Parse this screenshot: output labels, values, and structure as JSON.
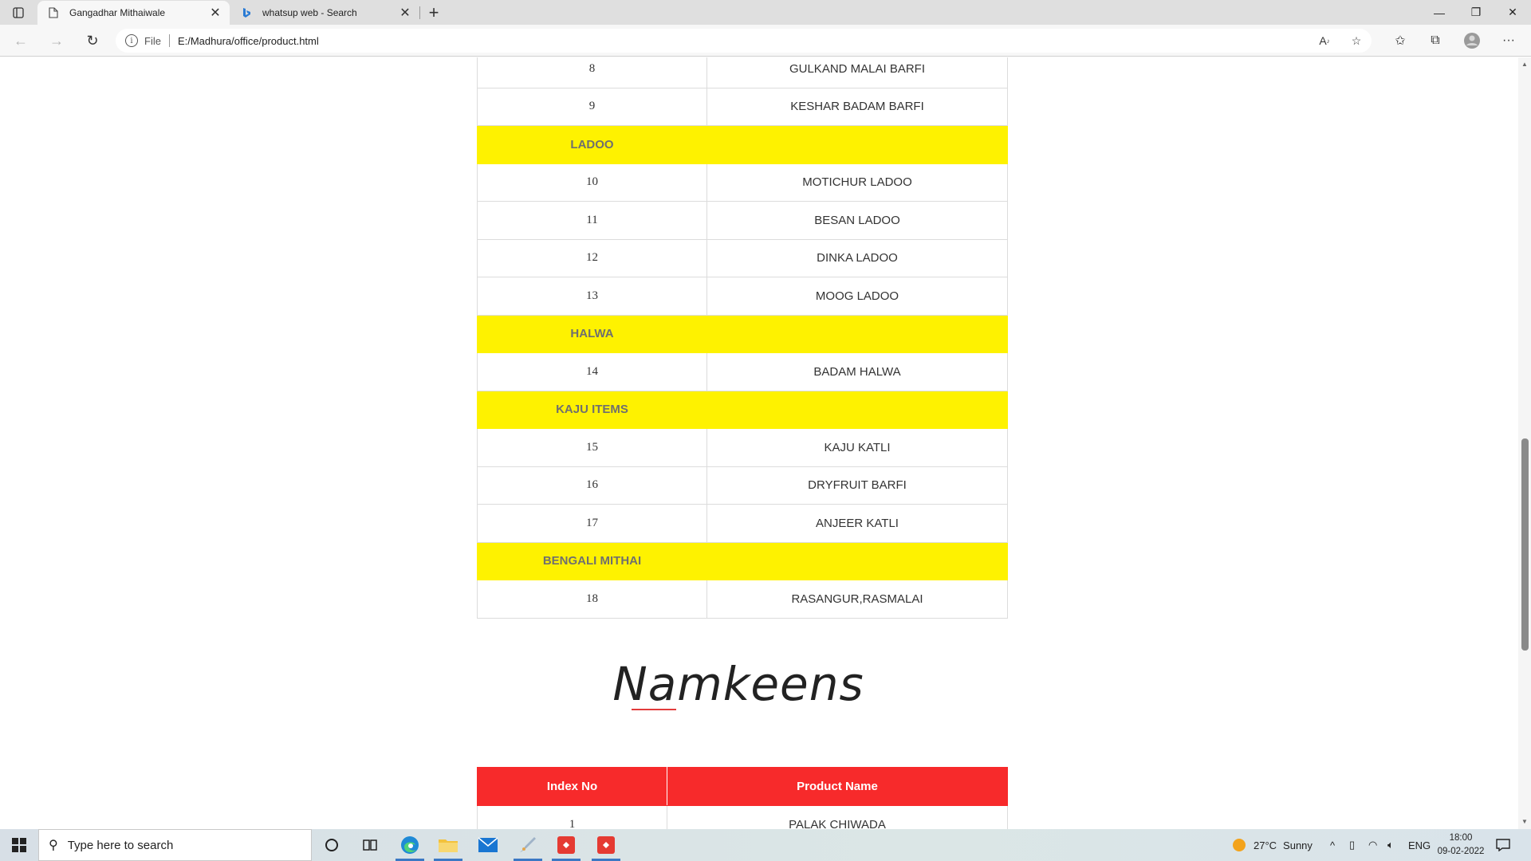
{
  "browser": {
    "tabs": [
      {
        "title": "Gangadhar Mithaiwale",
        "icon": "page-icon",
        "active": true
      },
      {
        "title": "whatsup web - Search",
        "icon": "bing-icon",
        "active": false
      }
    ],
    "address": {
      "scheme_label": "File",
      "url": "E:/Madhura/office/product.html"
    }
  },
  "sweets_rows": [
    {
      "type": "item",
      "index": "8",
      "name": "GULKAND MALAI BARFI"
    },
    {
      "type": "item",
      "index": "9",
      "name": "KESHAR BADAM BARFI"
    },
    {
      "type": "category",
      "index": "LADOO",
      "name": ""
    },
    {
      "type": "item",
      "index": "10",
      "name": "MOTICHUR LADOO"
    },
    {
      "type": "item",
      "index": "11",
      "name": "BESAN LADOO"
    },
    {
      "type": "item",
      "index": "12",
      "name": "DINKA LADOO"
    },
    {
      "type": "item",
      "index": "13",
      "name": "MOOG LADOO"
    },
    {
      "type": "category",
      "index": "HALWA",
      "name": ""
    },
    {
      "type": "item",
      "index": "14",
      "name": "BADAM HALWA"
    },
    {
      "type": "category",
      "index": "KAJU ITEMS",
      "name": ""
    },
    {
      "type": "item",
      "index": "15",
      "name": "KAJU KATLI"
    },
    {
      "type": "item",
      "index": "16",
      "name": "DRYFRUIT BARFI"
    },
    {
      "type": "item",
      "index": "17",
      "name": "ANJEER KATLI"
    },
    {
      "type": "category",
      "index": "BENGALI MITHAI",
      "name": ""
    },
    {
      "type": "item",
      "index": "18",
      "name": "RASANGUR,RASMALAI"
    }
  ],
  "namkeens": {
    "title": "Namkeens",
    "headers": [
      "Index No",
      "Product Name"
    ],
    "rows": [
      {
        "index": "1",
        "name": "PALAK CHIWADA"
      }
    ]
  },
  "colors": {
    "category_bg": "#fef200",
    "header_bg": "#f72a2b"
  },
  "taskbar": {
    "search_placeholder": "Type here to search",
    "weather": {
      "temp": "27°C",
      "condition": "Sunny"
    },
    "language": "ENG",
    "time": "18:00",
    "date": "09-02-2022"
  }
}
